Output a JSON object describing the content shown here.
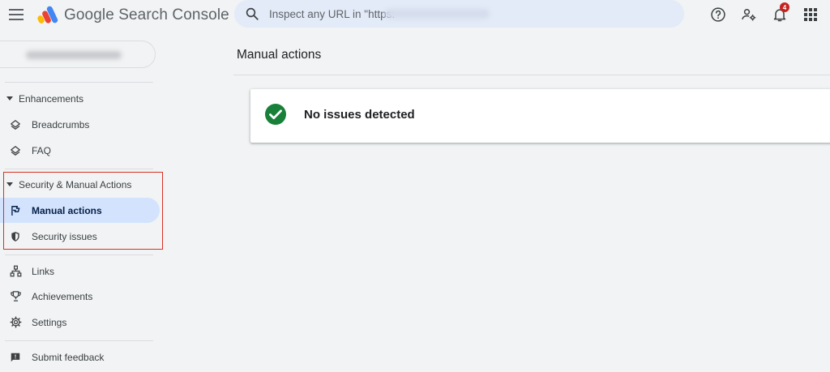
{
  "app": {
    "title": "Google Search Console"
  },
  "search": {
    "placeholder": "Inspect any URL in \"https:"
  },
  "header": {
    "notifications_count": "4",
    "icons": [
      "menu-icon",
      "help-icon",
      "manage-users-icon",
      "notifications-icon",
      "apps-icon"
    ]
  },
  "sidebar": {
    "sections": [
      {
        "label": "Enhancements",
        "items": [
          {
            "label": "Breadcrumbs",
            "icon": "layers-icon"
          },
          {
            "label": "FAQ",
            "icon": "layers-icon"
          }
        ]
      },
      {
        "label": "Security & Manual Actions",
        "items": [
          {
            "label": "Manual actions",
            "icon": "flag-icon",
            "active": true
          },
          {
            "label": "Security issues",
            "icon": "shield-icon"
          }
        ]
      }
    ],
    "items": [
      {
        "label": "Links",
        "icon": "sitemap-icon"
      },
      {
        "label": "Achievements",
        "icon": "trophy-icon"
      },
      {
        "label": "Settings",
        "icon": "gear-icon"
      }
    ],
    "footer": {
      "label": "Submit feedback",
      "icon": "feedback-icon"
    }
  },
  "main": {
    "title": "Manual actions",
    "status_message": "No issues detected"
  },
  "colors": {
    "accent_active": "#d3e3fd",
    "success": "#188038",
    "highlight_border": "#d93025"
  }
}
